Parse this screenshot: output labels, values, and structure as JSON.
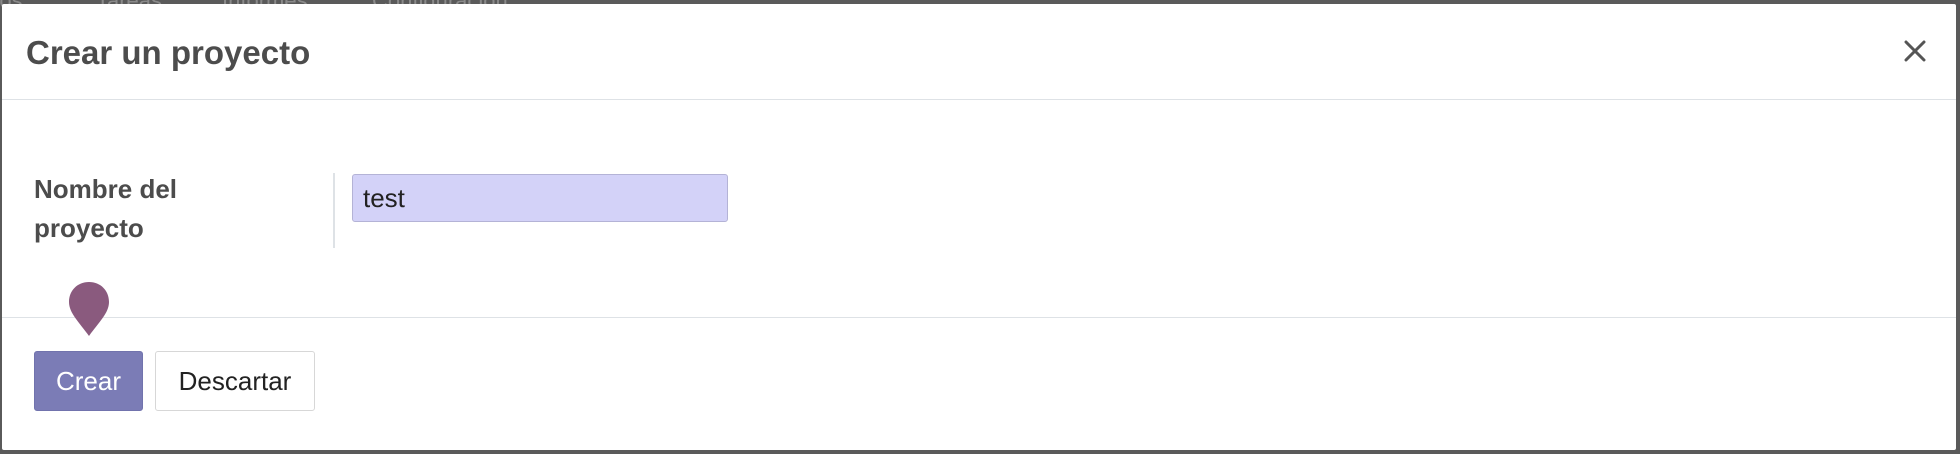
{
  "backdrop": {
    "nav_items": [
      "ros",
      "Tareas",
      "Informes",
      "Configuración"
    ]
  },
  "dialog": {
    "title": "Crear un proyecto",
    "close_icon": "close-icon"
  },
  "form": {
    "project_name": {
      "label_line1": "Nombre del",
      "label_line2": "proyecto",
      "value": "test"
    }
  },
  "footer": {
    "create_label": "Crear",
    "discard_label": "Descartar"
  },
  "colors": {
    "primary": "#7b7cb6",
    "input_bg": "#d3d2f8",
    "marker": "#8a5a7e"
  }
}
